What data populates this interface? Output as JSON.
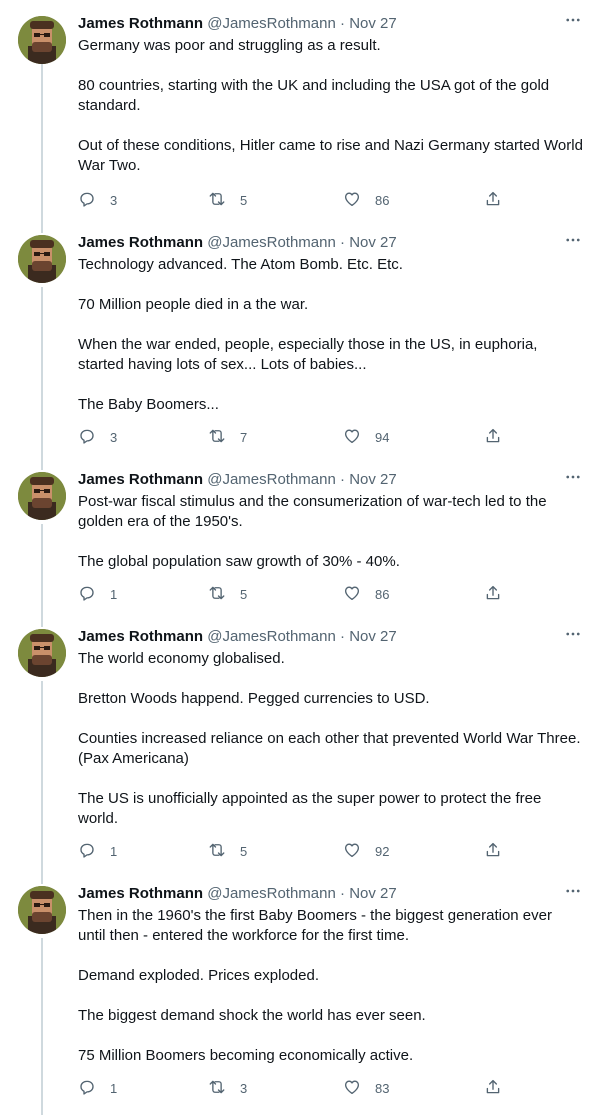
{
  "tweets": [
    {
      "name": "James Rothmann",
      "handle": "@JamesRothmann",
      "dot": "·",
      "date": "Nov 27",
      "paragraphs": [
        "Germany was poor and struggling as a result.",
        "80 countries, starting with the UK and including the USA got of the gold standard.",
        "Out of these conditions, Hitler came to rise and Nazi Germany started World War Two."
      ],
      "replies": "3",
      "retweets": "5",
      "likes": "86"
    },
    {
      "name": "James Rothmann",
      "handle": "@JamesRothmann",
      "dot": "·",
      "date": "Nov 27",
      "paragraphs": [
        "Technology advanced. The Atom Bomb. Etc. Etc.",
        "70 Million people died in a the war.",
        "When the war ended, people, especially those in the US, in euphoria, started having lots of sex... Lots of babies...",
        "The Baby Boomers..."
      ],
      "replies": "3",
      "retweets": "7",
      "likes": "94"
    },
    {
      "name": "James Rothmann",
      "handle": "@JamesRothmann",
      "dot": "·",
      "date": "Nov 27",
      "paragraphs": [
        "Post-war fiscal stimulus and the consumerization of war-tech led to the golden era of the 1950's.",
        "The global population saw growth of 30% - 40%."
      ],
      "replies": "1",
      "retweets": "5",
      "likes": "86"
    },
    {
      "name": "James Rothmann",
      "handle": "@JamesRothmann",
      "dot": "·",
      "date": "Nov 27",
      "paragraphs": [
        "The world economy globalised.",
        "Bretton Woods happend. Pegged currencies to USD.",
        "Counties increased reliance on each other that prevented World War Three. (Pax Americana)",
        "The US is unofficially appointed as the super power to protect the free world."
      ],
      "replies": "1",
      "retweets": "5",
      "likes": "92"
    },
    {
      "name": "James Rothmann",
      "handle": "@JamesRothmann",
      "dot": "·",
      "date": "Nov 27",
      "paragraphs": [
        "Then in the 1960's the first Baby Boomers - the biggest generation ever until then - entered the workforce for the first time.",
        "Demand exploded. Prices exploded.",
        "The biggest demand shock the world has ever seen.",
        "75 Million Boomers becoming economically active."
      ],
      "replies": "1",
      "retweets": "3",
      "likes": "83"
    }
  ],
  "icons": {
    "more": "more-horizontal-icon",
    "reply": "reply-icon",
    "retweet": "retweet-icon",
    "like": "heart-icon",
    "share": "share-icon"
  },
  "colors": {
    "text": "#0f1419",
    "secondary": "#536471",
    "thread_line": "#cfd9de"
  }
}
